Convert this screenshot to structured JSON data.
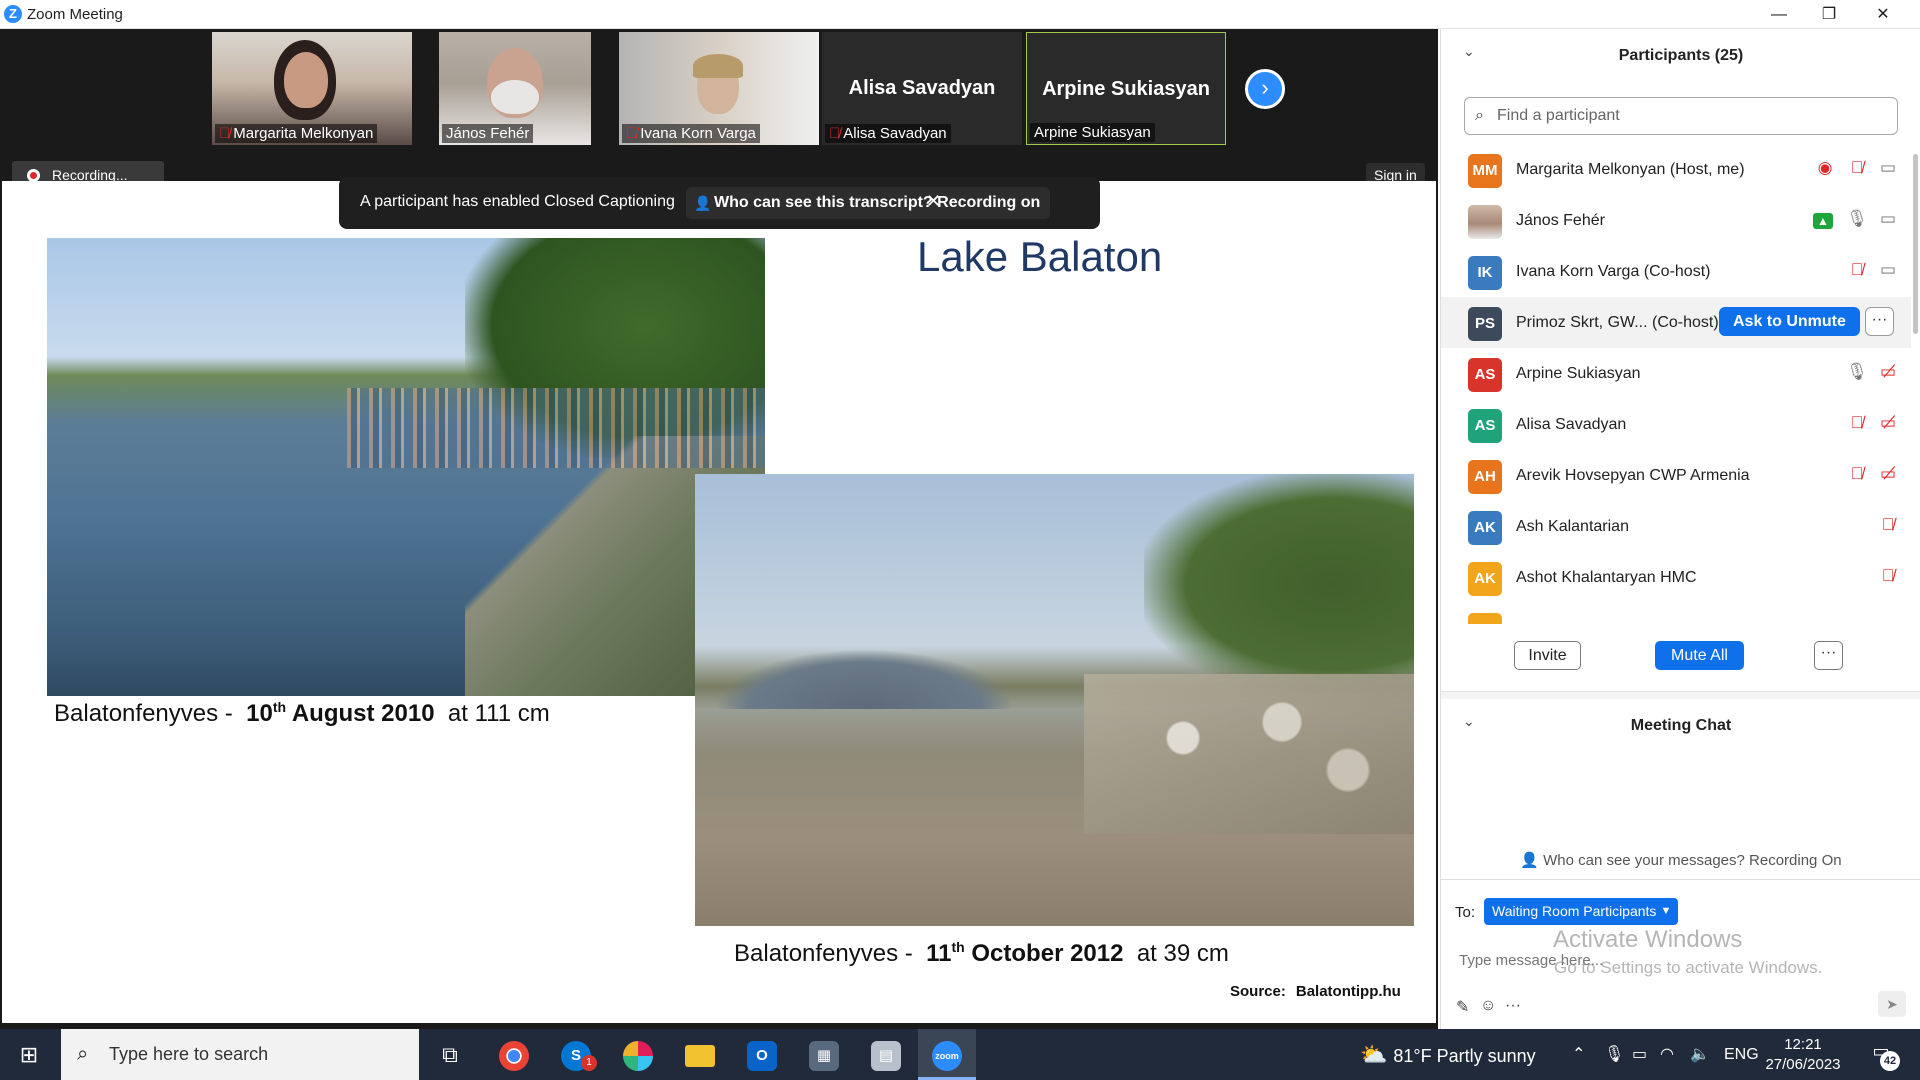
{
  "window": {
    "title": "Zoom Meeting",
    "controls": {
      "minimize": "—",
      "restore": "❐",
      "close": "✕"
    }
  },
  "meeting": {
    "thumbnails": [
      {
        "name": "Margarita Melkonyan",
        "muted": true,
        "video": true
      },
      {
        "name": "János Fehér",
        "muted": false,
        "video": true
      },
      {
        "name": "Ivana Korn Varga",
        "muted": true,
        "video": true
      },
      {
        "name": "Alisa Savadyan",
        "display_name": "Alisa Savadyan",
        "muted": true,
        "video": false
      },
      {
        "name": "Arpine Sukiasyan",
        "display_name": "Arpine Sukiasyan",
        "muted": false,
        "video": false,
        "active_speaker": true
      }
    ],
    "recording_label": "Recording...",
    "sign_in_label": "Sign in",
    "cc_toast": {
      "message": "A participant has enabled Closed Captioning",
      "transcript_notice": "Who can see this transcript? Recording on",
      "close": "✕"
    }
  },
  "slide": {
    "title": "Lake Balaton",
    "caption1": {
      "place": "Balatonfenyves -",
      "day": "10",
      "suffix": "th",
      "date_rest": "August 2010",
      "level": "at 111 cm"
    },
    "caption2": {
      "place": "Balatonfenyves -",
      "day": "11",
      "suffix": "th",
      "date_rest": "October 2012",
      "level": "at 39 cm"
    },
    "source_label": "Source:",
    "source_value": "Balatontipp.hu"
  },
  "participants_panel": {
    "title": "Participants (25)",
    "search_placeholder": "Find a participant",
    "rows": [
      {
        "initials": "MM",
        "name": "Margarita Melkonyan (Host, me)",
        "color": "#e8741c"
      },
      {
        "initials": "",
        "name": "János Fehér",
        "color": ""
      },
      {
        "initials": "IK",
        "name": "Ivana Korn Varga (Co-host)",
        "color": "#3a7bbf"
      },
      {
        "initials": "PS",
        "name": "Primoz Skrt, GW...  (Co-host)",
        "color": "#3d4a5c"
      },
      {
        "initials": "AS",
        "name": "Arpine Sukiasyan",
        "color": "#d9342b"
      },
      {
        "initials": "AS",
        "name": "Alisa Savadyan",
        "color": "#1ea37a"
      },
      {
        "initials": "AH",
        "name": "Arevik Hovsepyan CWP Armenia",
        "color": "#e8741c"
      },
      {
        "initials": "AK",
        "name": "Ash Kalantarian",
        "color": "#3a7bbf"
      },
      {
        "initials": "AK",
        "name": "Ashot Khalantaryan HMC",
        "color": "#f2a51a"
      }
    ],
    "ask_to_unmute": "Ask to Unmute",
    "row_more": "···",
    "invite": "Invite",
    "mute_all": "Mute All",
    "more": "···"
  },
  "chat": {
    "title": "Meeting Chat",
    "notice": "Who can see your messages? Recording On",
    "to_label": "To:",
    "recipient": "Waiting Room Participants",
    "input_placeholder": "Type message here...",
    "activate_line1": "Activate Windows",
    "activate_line2": "Go to Settings to activate Windows."
  },
  "taskbar": {
    "search_placeholder": "Type here to search",
    "weather": "81°F  Partly sunny",
    "language": "ENG",
    "time": "12:21",
    "date": "27/06/2023",
    "notification_count": "42",
    "skype_badge": "1"
  }
}
